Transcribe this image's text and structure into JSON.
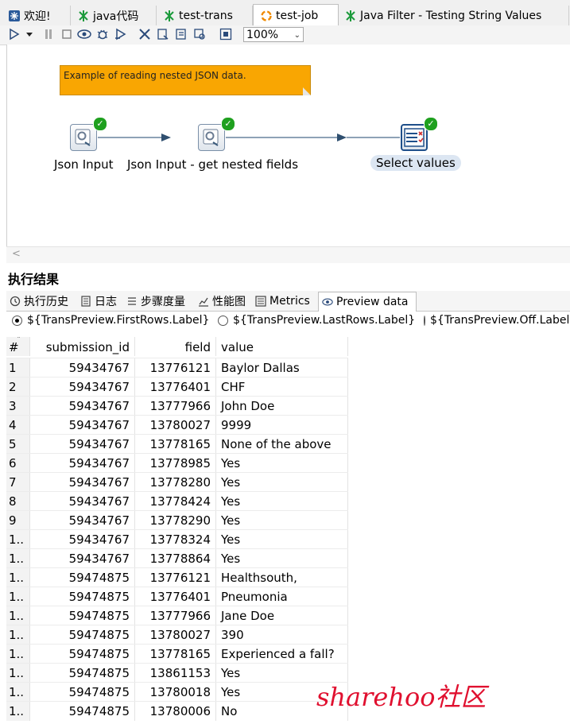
{
  "tabs": [
    {
      "label": "欢迎!",
      "icon": "welcome-icon",
      "active": false
    },
    {
      "label": "java代码",
      "icon": "transformation-icon",
      "active": false
    },
    {
      "label": "test-trans",
      "icon": "transformation-icon",
      "active": false
    },
    {
      "label": "test-job",
      "icon": "job-icon",
      "active": true
    },
    {
      "label": "Java Filter - Testing String Values",
      "icon": "transformation-icon",
      "active": false
    }
  ],
  "toolbar": {
    "zoom": "100%",
    "icons": [
      "run-icon",
      "run-dropdown-icon",
      "pause-icon",
      "stop-icon",
      "preview-icon",
      "debug-icon",
      "replay-icon",
      "verify-icon",
      "impact-icon",
      "sql-icon",
      "explore-db-icon",
      "show-results-icon"
    ]
  },
  "canvas": {
    "note": "Example of reading nested JSON data.",
    "steps": [
      {
        "label": "Json Input",
        "icon": "json-input-icon"
      },
      {
        "label": "Json Input - get nested fields",
        "icon": "json-input-icon"
      },
      {
        "label": "Select values",
        "icon": "select-values-icon"
      }
    ],
    "scroll_left": "<"
  },
  "results": {
    "title": "执行结果",
    "tabs": [
      {
        "label": "执行历史",
        "icon": "history-icon"
      },
      {
        "label": "日志",
        "icon": "log-icon"
      },
      {
        "label": "步骤度量",
        "icon": "step-metrics-icon"
      },
      {
        "label": "性能图",
        "icon": "performance-icon"
      },
      {
        "label": "Metrics",
        "icon": "metrics-icon"
      },
      {
        "label": "Preview data",
        "icon": "preview-data-icon"
      }
    ],
    "radios": [
      {
        "label": "${TransPreview.FirstRows.Label}",
        "selected": true
      },
      {
        "label": "${TransPreview.LastRows.Label}",
        "selected": false
      },
      {
        "label": "${TransPreview.Off.Label}",
        "selected": false
      }
    ],
    "columns": [
      "#",
      "submission_id",
      "field",
      "value"
    ],
    "rows": [
      [
        "1",
        "59434767",
        "13776121",
        "Baylor Dallas"
      ],
      [
        "2",
        "59434767",
        "13776401",
        "CHF"
      ],
      [
        "3",
        "59434767",
        "13777966",
        "John Doe"
      ],
      [
        "4",
        "59434767",
        "13780027",
        "9999"
      ],
      [
        "5",
        "59434767",
        "13778165",
        "None of the above"
      ],
      [
        "6",
        "59434767",
        "13778985",
        "Yes"
      ],
      [
        "7",
        "59434767",
        "13778280",
        "Yes"
      ],
      [
        "8",
        "59434767",
        "13778424",
        "Yes"
      ],
      [
        "9",
        "59434767",
        "13778290",
        "Yes"
      ],
      [
        "1..",
        "59434767",
        "13778324",
        "Yes"
      ],
      [
        "1..",
        "59434767",
        "13778864",
        "Yes"
      ],
      [
        "1..",
        "59474875",
        "13776121",
        "Healthsouth,"
      ],
      [
        "1..",
        "59474875",
        "13776401",
        "Pneumonia"
      ],
      [
        "1..",
        "59474875",
        "13777966",
        "Jane Doe"
      ],
      [
        "1..",
        "59474875",
        "13780027",
        "390"
      ],
      [
        "1..",
        "59474875",
        "13778165",
        "Experienced a fall?"
      ],
      [
        "1..",
        "59474875",
        "13861153",
        "Yes"
      ],
      [
        "1..",
        "59474875",
        "13780018",
        "Yes"
      ],
      [
        "1..",
        "59474875",
        "13780006",
        "No"
      ]
    ]
  },
  "watermark": "sharehoo社区",
  "colors": {
    "note": "#f9a602",
    "ok": "#1fa01f",
    "watermark": "#e0102f",
    "hop": "#4a6a8a"
  }
}
